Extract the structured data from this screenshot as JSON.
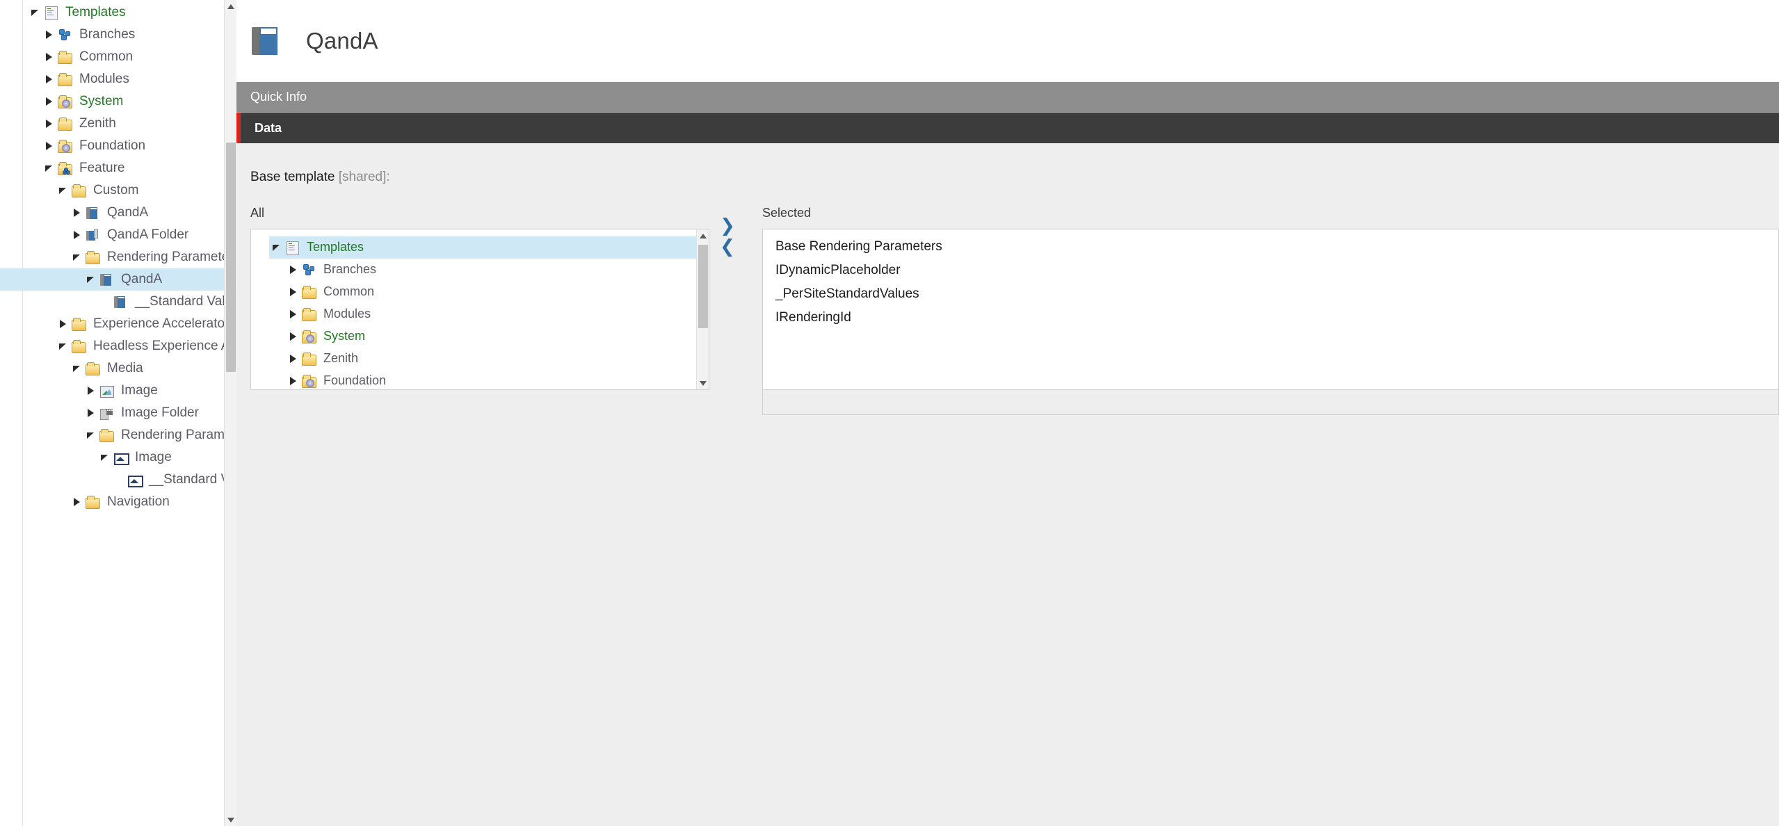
{
  "content_tree": {
    "items": [
      {
        "label": "Templates",
        "icon": "templates-doc-icon",
        "indent": 0,
        "twisty": "down",
        "selected": false,
        "green": true
      },
      {
        "label": "Branches",
        "icon": "puzzle-icon",
        "indent": 1,
        "twisty": "right",
        "selected": false,
        "green": false
      },
      {
        "label": "Common",
        "icon": "folder-icon",
        "indent": 1,
        "twisty": "right",
        "selected": false,
        "green": false
      },
      {
        "label": "Modules",
        "icon": "folder-icon",
        "indent": 1,
        "twisty": "right",
        "selected": false,
        "green": false
      },
      {
        "label": "System",
        "icon": "folder-gear-icon",
        "indent": 1,
        "twisty": "right",
        "selected": false,
        "green": true
      },
      {
        "label": "Zenith",
        "icon": "folder-icon",
        "indent": 1,
        "twisty": "right",
        "selected": false,
        "green": false
      },
      {
        "label": "Foundation",
        "icon": "folder-gear-icon",
        "indent": 1,
        "twisty": "right",
        "selected": false,
        "green": false
      },
      {
        "label": "Feature",
        "icon": "folder-feature-icon",
        "indent": 1,
        "twisty": "down",
        "selected": false,
        "green": false
      },
      {
        "label": "Custom",
        "icon": "folder-icon",
        "indent": 2,
        "twisty": "down",
        "selected": false,
        "green": false
      },
      {
        "label": "QandA",
        "icon": "template-book-icon",
        "indent": 3,
        "twisty": "right",
        "selected": false,
        "green": false
      },
      {
        "label": "QandA Folder",
        "icon": "template-folder-icon",
        "indent": 3,
        "twisty": "right",
        "selected": false,
        "green": false
      },
      {
        "label": "Rendering Parameters",
        "icon": "folder-icon",
        "indent": 3,
        "twisty": "down",
        "selected": false,
        "green": false
      },
      {
        "label": "QandA",
        "icon": "template-book-icon",
        "indent": 4,
        "twisty": "down",
        "selected": true,
        "green": false
      },
      {
        "label": "__Standard Values",
        "icon": "template-book-icon",
        "indent": 5,
        "twisty": "none",
        "selected": false,
        "green": false
      },
      {
        "label": "Experience Accelerator",
        "icon": "folder-icon",
        "indent": 2,
        "twisty": "right",
        "selected": false,
        "green": false
      },
      {
        "label": "Headless Experience Accelera",
        "icon": "folder-icon",
        "indent": 2,
        "twisty": "down",
        "selected": false,
        "green": false
      },
      {
        "label": "Media",
        "icon": "folder-icon",
        "indent": 3,
        "twisty": "down",
        "selected": false,
        "green": false
      },
      {
        "label": "Image",
        "icon": "image-icon",
        "indent": 4,
        "twisty": "right",
        "selected": false,
        "green": false
      },
      {
        "label": "Image Folder",
        "icon": "image-folder-icon",
        "indent": 4,
        "twisty": "right",
        "selected": false,
        "green": false
      },
      {
        "label": "Rendering Parameters",
        "icon": "folder-icon",
        "indent": 4,
        "twisty": "down",
        "selected": false,
        "green": false
      },
      {
        "label": "Image",
        "icon": "rendering-image-icon",
        "indent": 5,
        "twisty": "down",
        "selected": false,
        "green": false
      },
      {
        "label": "__Standard Values",
        "icon": "rendering-image-icon",
        "indent": 6,
        "twisty": "none",
        "selected": false,
        "green": false
      },
      {
        "label": "Navigation",
        "icon": "folder-icon",
        "indent": 3,
        "twisty": "right",
        "selected": false,
        "green": false
      }
    ]
  },
  "editor": {
    "item_title": "QandA",
    "item_icon": "template-book-icon",
    "sections": {
      "quick_info": "Quick Info",
      "data": "Data"
    },
    "accent_color": "#d9261c",
    "data_section": {
      "field_label": "Base template",
      "field_label_suffix": "[shared]:",
      "all_heading": "All",
      "selected_heading": "Selected",
      "add_button": "❯",
      "remove_button": "❮",
      "all_tree": [
        {
          "label": "Templates",
          "icon": "templates-doc-icon",
          "indent": 0,
          "twisty": "down",
          "selected": true,
          "green": true
        },
        {
          "label": "Branches",
          "icon": "puzzle-icon",
          "indent": 1,
          "twisty": "right",
          "selected": false,
          "green": false
        },
        {
          "label": "Common",
          "icon": "folder-icon",
          "indent": 1,
          "twisty": "right",
          "selected": false,
          "green": false
        },
        {
          "label": "Modules",
          "icon": "folder-icon",
          "indent": 1,
          "twisty": "right",
          "selected": false,
          "green": false
        },
        {
          "label": "System",
          "icon": "folder-gear-icon",
          "indent": 1,
          "twisty": "right",
          "selected": false,
          "green": true
        },
        {
          "label": "Zenith",
          "icon": "folder-icon",
          "indent": 1,
          "twisty": "right",
          "selected": false,
          "green": false
        },
        {
          "label": "Foundation",
          "icon": "folder-gear-icon",
          "indent": 1,
          "twisty": "right",
          "selected": false,
          "green": false
        }
      ],
      "selected_items": [
        "Base Rendering Parameters",
        "IDynamicPlaceholder",
        "_PerSiteStandardValues",
        "IRenderingId"
      ]
    }
  }
}
